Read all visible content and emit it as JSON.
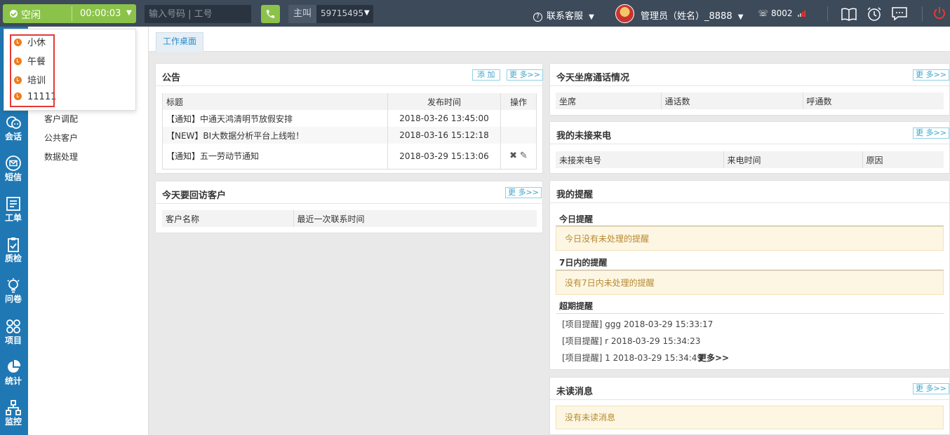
{
  "topbar": {
    "status_label": "空闲",
    "status_timer": "00:00:03",
    "dial_placeholder": "输入号码 | 工号",
    "caller_label": "主叫",
    "caller_number": "59715495",
    "help_label": "联系客服",
    "admin_label": "管理员（姓名）_8888",
    "extension": "8002",
    "colors": {
      "bar": "#3d4a5a",
      "accent_green": "#8bc34a",
      "power": "#e53935"
    }
  },
  "status_dropdown": {
    "items": [
      "小休",
      "午餐",
      "培训",
      "11111"
    ],
    "highlight_color": "#e53935"
  },
  "sidebar": {
    "items": [
      {
        "label": "会话",
        "icon": "chat-icon"
      },
      {
        "label": "短信",
        "icon": "mail-icon"
      },
      {
        "label": "工单",
        "icon": "ticket-icon"
      },
      {
        "label": "质检",
        "icon": "clipboard-icon"
      },
      {
        "label": "问卷",
        "icon": "bulb-icon"
      },
      {
        "label": "项目",
        "icon": "grid-icon"
      },
      {
        "label": "统计",
        "icon": "pie-icon"
      },
      {
        "label": "监控",
        "icon": "network-icon"
      }
    ],
    "color": "#1f78b4"
  },
  "subnav": {
    "items": [
      "客户调配",
      "公共客户",
      "数据处理"
    ]
  },
  "tabs": [
    {
      "label": "工作桌面"
    }
  ],
  "announcements": {
    "title": "公告",
    "add_label": "添 加",
    "more_label": "更 多>>",
    "columns": [
      "标题",
      "发布时间",
      "操作"
    ],
    "rows": [
      {
        "title": "【通知】中通天鸿清明节放假安排",
        "time": "2018-03-26 13:45:00"
      },
      {
        "title": "【NEW】BI大数据分析平台上线啦！",
        "time": "2018-03-16 15:12:18"
      },
      {
        "title": "【通知】五一劳动节通知",
        "time": "2018-03-29 15:13:06"
      }
    ]
  },
  "revisit": {
    "title": "今天要回访客户",
    "more_label": "更 多>>",
    "columns": [
      "客户名称",
      "最近一次联系时间"
    ]
  },
  "agent_calls": {
    "title": "今天坐席通话情况",
    "more_label": "更 多>>",
    "columns": [
      "坐席",
      "通话数",
      "呼通数"
    ]
  },
  "missed_calls": {
    "title": "我的未接来电",
    "more_label": "更 多>>",
    "columns": [
      "未接来电号",
      "来电时间",
      "原因"
    ]
  },
  "reminders": {
    "title": "我的提醒",
    "today_title": "今日提醒",
    "today_empty": "今日没有未处理的提醒",
    "week_title": "7日内的提醒",
    "week_empty": "没有7日内未处理的提醒",
    "overdue_title": "超期提醒",
    "overdue_items": [
      "[项目提醒] ggg  2018-03-29 15:33:17",
      "[项目提醒] r  2018-03-29 15:34:23",
      "[项目提醒] 1  2018-03-29 15:34:49"
    ],
    "overdue_more": "更多>>"
  },
  "unread": {
    "title": "未读消息",
    "more_label": "更 多>>",
    "empty": "没有未读消息"
  }
}
